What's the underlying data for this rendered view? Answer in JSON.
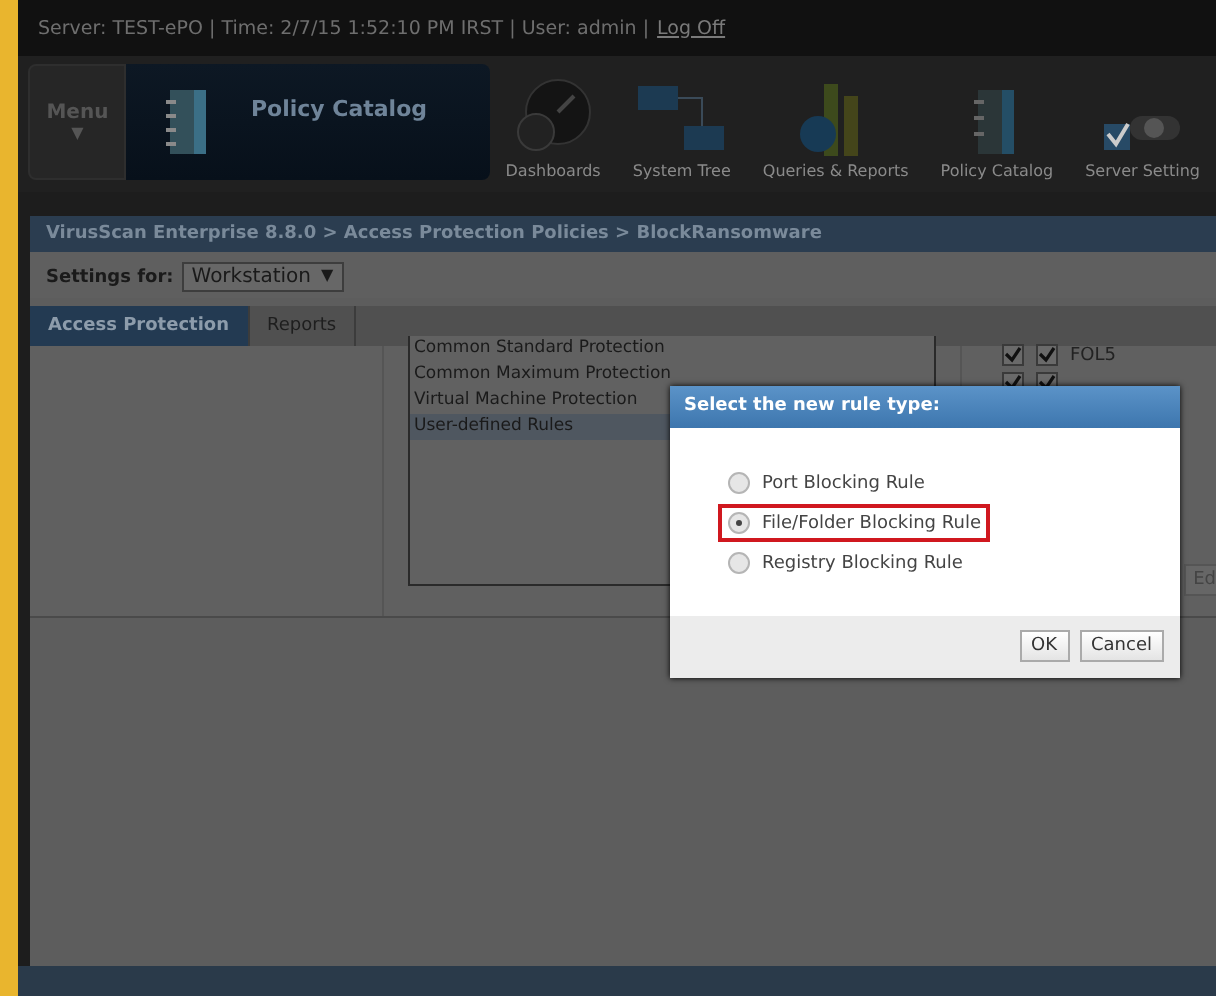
{
  "status_line": {
    "text": "Server: TEST-ePO | Time: 2/7/15 1:52:10 PM IRST | User: admin |",
    "logoff": "Log Off"
  },
  "nav": {
    "menu": {
      "label": "Menu",
      "caret": "▼"
    },
    "current_page": "Policy Catalog",
    "items": [
      {
        "label": "Dashboards",
        "kind": "dashboard"
      },
      {
        "label": "System Tree",
        "kind": "tree"
      },
      {
        "label": "Queries & Reports",
        "kind": "chart"
      },
      {
        "label": "Policy Catalog",
        "kind": "catalog"
      },
      {
        "label": "Server Setting",
        "kind": "settings"
      }
    ]
  },
  "breadcrumb": "VirusScan Enterprise 8.8.0 > Access Protection Policies > BlockRansomware",
  "settings_for": {
    "label": "Settings for:",
    "value": "Workstation",
    "caret": "▼"
  },
  "tabs": [
    {
      "label": "Access Protection",
      "selected": true
    },
    {
      "label": "Reports",
      "selected": false
    }
  ],
  "categories": [
    {
      "label": "Common Standard Protection",
      "selected": false
    },
    {
      "label": "Common Maximum Protection",
      "selected": false
    },
    {
      "label": "Virtual Machine Protection",
      "selected": false
    },
    {
      "label": "User-defined Rules",
      "selected": true
    }
  ],
  "rules": [
    {
      "block": true,
      "report": true,
      "name": "FOL5"
    },
    {
      "block": true,
      "report": true
    }
  ],
  "edit_button": "Ed",
  "dialog": {
    "title": "Select the new rule type:",
    "options": [
      {
        "label": "Port Blocking Rule",
        "selected": false
      },
      {
        "label": "File/Folder Blocking Rule",
        "selected": true
      },
      {
        "label": "Registry Blocking Rule",
        "selected": false
      }
    ],
    "buttons": [
      "OK",
      "Cancel"
    ]
  }
}
